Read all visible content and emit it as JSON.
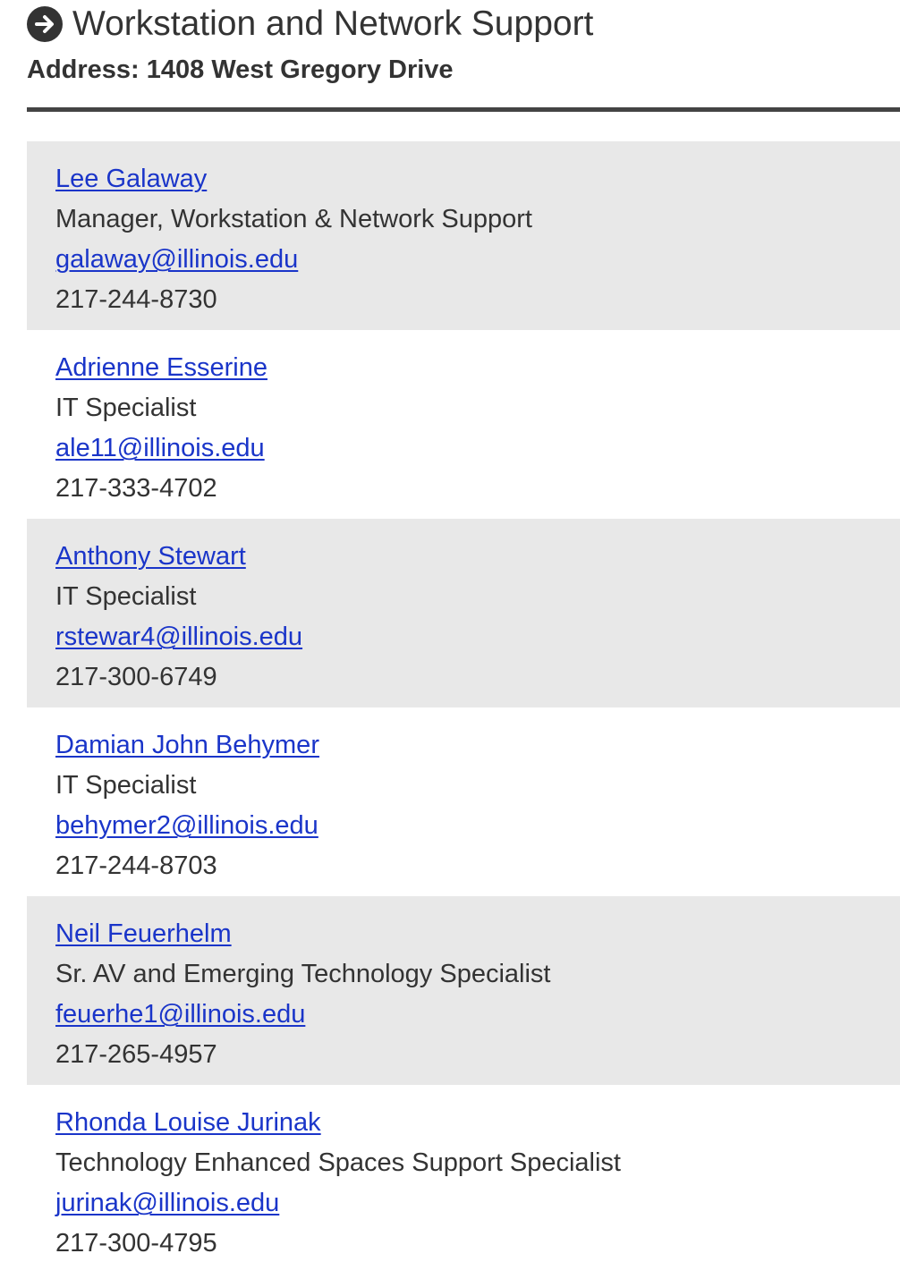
{
  "header": {
    "title": "Workstation and Network Support",
    "address": "Address: 1408 West Gregory Drive",
    "icon": "arrow-right-circle-icon"
  },
  "colors": {
    "link": "#1a35c9",
    "text": "#333333",
    "shaded_row": "#e8e8e8",
    "rule": "#444444"
  },
  "staff": [
    {
      "name": "Lee Galaway",
      "role": "Manager, Workstation & Network Support",
      "email": "galaway@illinois.edu",
      "phone": "217-244-8730"
    },
    {
      "name": "Adrienne Esserine",
      "role": "IT Specialist",
      "email": "ale11@illinois.edu",
      "phone": "217-333-4702"
    },
    {
      "name": "Anthony Stewart",
      "role": "IT Specialist",
      "email": "rstewar4@illinois.edu",
      "phone": "217-300-6749"
    },
    {
      "name": "Damian John Behymer",
      "role": "IT Specialist",
      "email": "behymer2@illinois.edu",
      "phone": "217-244-8703"
    },
    {
      "name": "Neil Feuerhelm",
      "role": "Sr. AV and Emerging Technology Specialist",
      "email": "feuerhe1@illinois.edu",
      "phone": "217-265-4957"
    },
    {
      "name": "Rhonda Louise Jurinak",
      "role": "Technology Enhanced Spaces Support Specialist",
      "email": "jurinak@illinois.edu",
      "phone": "217-300-4795"
    }
  ]
}
